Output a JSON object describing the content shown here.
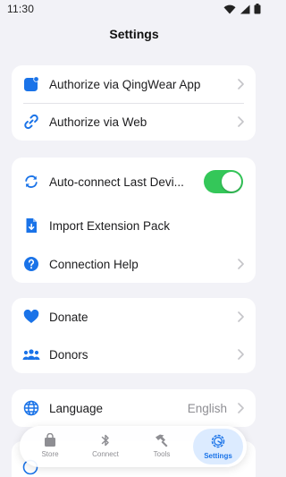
{
  "status_bar": {
    "time": "11:30"
  },
  "page_title": "Settings",
  "groups": [
    {
      "items": [
        {
          "label": "Authorize via QingWear App",
          "icon": "app-badge-icon"
        },
        {
          "label": "Authorize via Web",
          "icon": "link-icon"
        }
      ]
    },
    {
      "items": [
        {
          "label": "Auto-connect Last Devi...",
          "icon": "sync-icon",
          "toggle_on": true
        },
        {
          "label": "Import Extension Pack",
          "icon": "file-import-icon"
        },
        {
          "label": "Connection Help",
          "icon": "help-icon"
        }
      ]
    },
    {
      "items": [
        {
          "label": "Donate",
          "icon": "heart-icon"
        },
        {
          "label": "Donors",
          "icon": "people-icon"
        }
      ]
    },
    {
      "items": [
        {
          "label": "Language",
          "value": "English",
          "icon": "globe-icon"
        }
      ]
    }
  ],
  "tabbar": {
    "tabs": [
      {
        "label": "Store",
        "icon": "store-icon"
      },
      {
        "label": "Connect",
        "icon": "bluetooth-icon"
      },
      {
        "label": "Tools",
        "icon": "hammer-icon"
      },
      {
        "label": "Settings",
        "icon": "settings-icon",
        "active": true
      }
    ]
  },
  "colors": {
    "accent": "#1a73e8",
    "toggle_on": "#34c759",
    "background": "#f2f2f7",
    "card": "#ffffff"
  }
}
